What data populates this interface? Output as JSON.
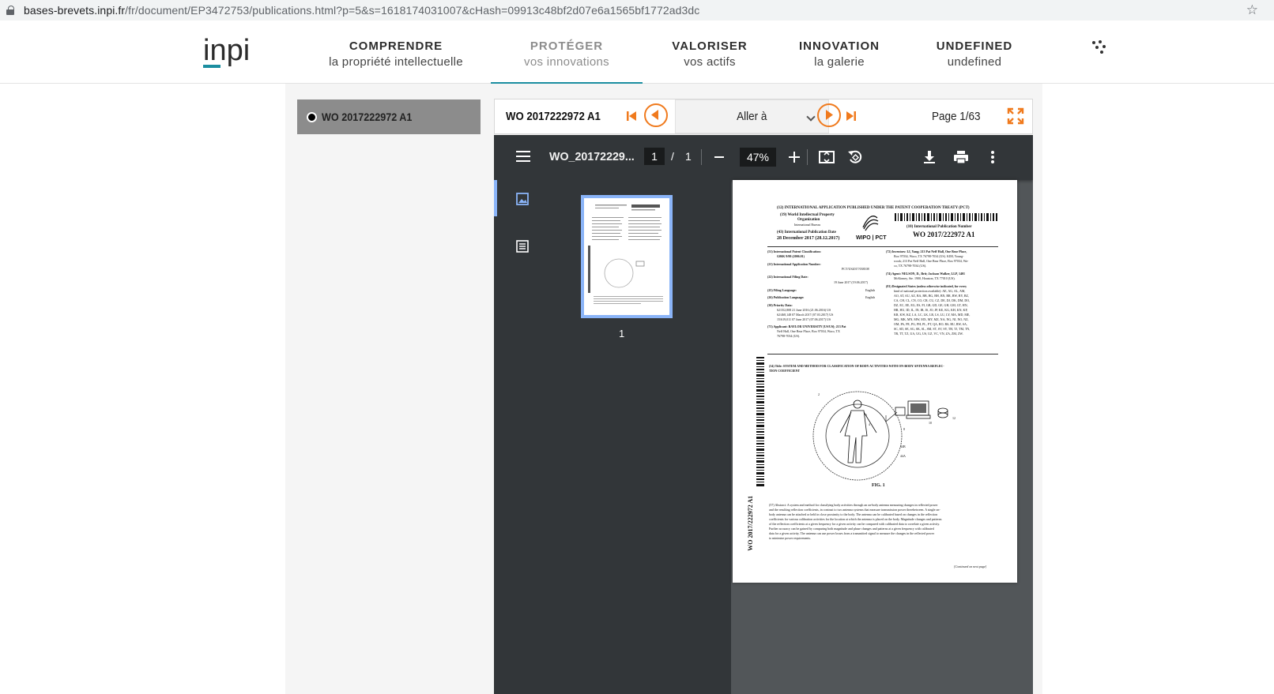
{
  "browser": {
    "url_host": "bases-brevets.inpi.fr",
    "url_path": "/fr/document/EP3472753/publications.html?p=5&s=1618174031007&cHash=09913c48bf2d07e6a1565bf1772ad3dc"
  },
  "header": {
    "logo_text": "inpi",
    "nav": [
      {
        "title": "COMPRENDRE",
        "subtitle": "la propriété intellectuelle"
      },
      {
        "title": "PROTÉGER",
        "subtitle": "vos innovations"
      },
      {
        "title": "VALORISER",
        "subtitle": "vos actifs"
      },
      {
        "title": "INNOVATION",
        "subtitle": "la galerie"
      },
      {
        "title": "UNDEFINED",
        "subtitle": "undefined"
      }
    ]
  },
  "sidebar": {
    "selected_doc": "WO 2017222972 A1"
  },
  "viewer": {
    "doc_title": "WO 2017222972 A1",
    "goto_label": "Aller à",
    "page_indicator": "Page 1/63"
  },
  "pdf": {
    "filename": "WO_20172229...",
    "current_page": "1",
    "slash": "/",
    "total_pages": "1",
    "zoom": "47%",
    "thumb_label": "1"
  },
  "patent": {
    "header_line": "(12) INTERNATIONAL APPLICATION PUBLISHED UNDER THE PATENT COOPERATION TREATY (PCT)",
    "org1": "(19) World Intellectual Property",
    "org2": "Organization",
    "bureau": "International Bureau",
    "pubdate_label": "(43) International Publication Date",
    "pubdate": "28 December 2017 (28.12.2017)",
    "wipo": "WIPO | PCT",
    "pubno_label": "(10) International Publication Number",
    "pubno": "WO 2017/222972 A1",
    "ipc_label": "(51) International Patent Classification:",
    "ipc": "G06K 9/00 (2006.01)",
    "appno_label": "(21) International Application Number:",
    "appno": "PCT/US2017/038108",
    "filingdate_label": "(22) International Filing Date:",
    "filingdate": "19 June 2017 (19.06.2017)",
    "lang_label": "(25) Filing Language:",
    "lang": "English",
    "publang_label": "(26) Publication Language:",
    "publang": "English",
    "priority_label": "(30) Priority Data:",
    "priority1": "62/352,808    21 June 2016 (21.06.2016)    US",
    "priority2": "62/468,148    07 March 2017 (07.03.2017)    US",
    "priority3": "15/619,011    07 June 2017 (07.06.2017)    US",
    "applicant_label": "(71) Applicant: BAYLOR UNIVERSITY [US/US]; 213 Pat",
    "applicant2": "Neff Hall, One Bear Place, Box 97034, Waco, TX",
    "applicant3": "76798-7034 (US).",
    "inventors": "(72) Inventors: LI, Yang; 213 Pat Neff Hall, One Bear Place,",
    "inventors2": "Box 97034, Waco, TX 76798-7034 (US). KIM, Young-",
    "inventors3": "wook; 213 Pat Neff Hall, One Bear Place, Box 97034, Wa-",
    "inventors4": "co, TX 76798-7034 (US).",
    "agent": "(74) Agent: NELSON, D., Brit; Jackson Walker, LLP, 1401",
    "agent2": "McKinney, Ste. 1900, Houston, TX 77010 (US).",
    "states": "(81) Designated States (unless otherwise indicated, for every",
    "states2": "kind of national protection available): AE, AG, AL, AM,",
    "states3": "AO, AT, AU, AZ, BA, BB, BG, BH, BN, BR, BW, BY, BZ,",
    "states4": "CA, CH, CL, CN, CO, CR, CU, CZ, DE, DJ, DK, DM, DO,",
    "states5": "DZ, EC, EE, EG, ES, FI, GB, GD, GE, GH, GM, GT, HN,",
    "states6": "HR, HU, ID, IL, IN, IR, IS, JO, JP, KE, KG, KH, KN, KP,",
    "states7": "KR, KW, KZ, LA, LC, LK, LR, LS, LU, LY, MA, MD, ME,",
    "states8": "MG, MK, MN, MW, MX, MY, MZ, NA, NG, NI, NO, NZ,",
    "states9": "OM, PA, PE, PG, PH, PL, PT, QA, RO, RS, RU, RW, SA,",
    "states10": "SC, SD, SE, SG, SK, SL, SM, ST, SV, SY, TH, TJ, TM, TN,",
    "states11": "TR, TT, TZ, UA, UG, US, UZ, VC, VN, ZA, ZM, ZW.",
    "title": "(54) Title: SYSTEM AND METHOD FOR CLASSIFICATION OF BODY ACTIVITIES WITH ON-BODY ANTENNA REFLEC-",
    "title2": "TION COEFFICIENT",
    "fig": "FIG. 1",
    "fig_n2": "2",
    "fig_n6": "6",
    "fig_n4": "4",
    "fig_n8": "8",
    "fig_n10": "10",
    "fig_n12": "12",
    "fig_n44b": "44B",
    "fig_n44a": "44A",
    "side_number": "WO 2017/222972 A1",
    "abstract": "(57) Abstract: A system and method for classifying body activities through an on-body antenna measuring changes in reflected power",
    "abstract2": "and the resulting reflection coefficients, in contrast to two antenna systems that measure transmission power therebetween. A single on-",
    "abstract3": "body antenna can be attached or held in close proximity to the body. The antenna can be calibrated based on changes in the reflection",
    "abstract4": "coefficients for various calibration activities for the location at which the antenna is placed on the body. Magnitude changes and patterns",
    "abstract5": "of the reflection coefficients at a given frequency for a given activity can be compared with calibrated data to correlate a given activity.",
    "abstract6": "Further accuracy can be gained by comparing both magnitude and phase changes and patterns at a given frequency with calibrated",
    "abstract7": "data for a given activity. The antenna can use power losses from a transmitted signal to measure the changes in the reflected power",
    "abstract8": "to minimize power requirements.",
    "continued": "[Continued on next page]"
  }
}
